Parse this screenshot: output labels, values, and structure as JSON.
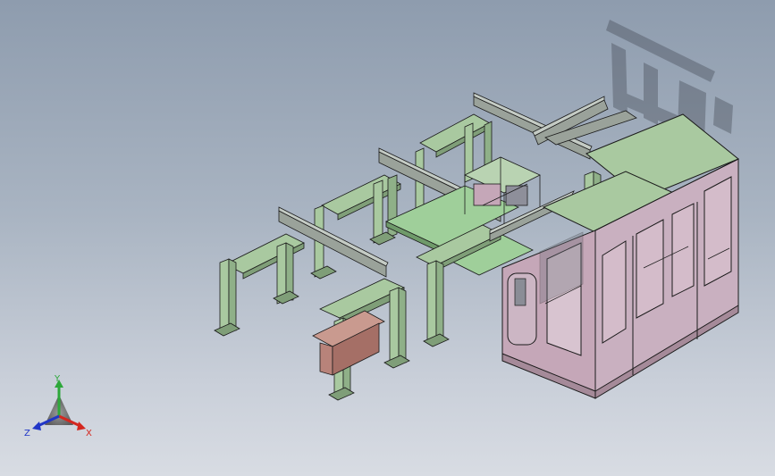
{
  "viewport": {
    "background_top": "#8e9cae",
    "background_bottom": "#d8dce3"
  },
  "model": {
    "frame_color": "#a9c9a0",
    "cabinet_color": "#c5a7b8",
    "panel_color": "#9fcf9a",
    "bin_color": "#b8837a",
    "edge_color": "#1b1b1b"
  },
  "triad": {
    "x_label": "X",
    "y_label": "Y",
    "z_label": "Z",
    "x_color": "#d4271f",
    "y_color": "#2da83a",
    "z_color": "#2136c7"
  }
}
